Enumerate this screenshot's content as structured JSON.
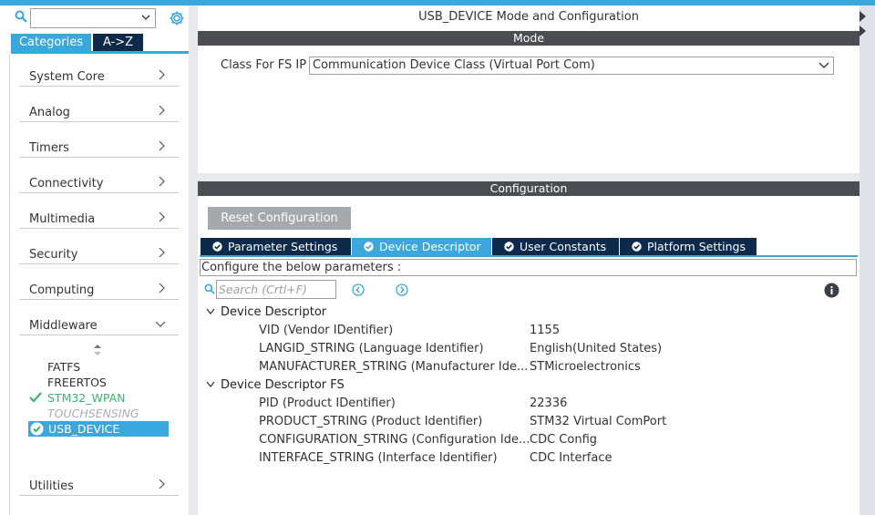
{
  "left_panel": {
    "search": {
      "value": ""
    },
    "tabs": {
      "categories": "Categories",
      "az": "A->Z"
    },
    "categories": [
      {
        "label": "System Core"
      },
      {
        "label": "Analog"
      },
      {
        "label": "Timers"
      },
      {
        "label": "Connectivity"
      },
      {
        "label": "Multimedia"
      },
      {
        "label": "Security"
      },
      {
        "label": "Computing"
      },
      {
        "label": "Middleware"
      },
      {
        "label": "Utilities"
      }
    ],
    "middleware_items": {
      "fatfs": "FATFS",
      "freertos": "FREERTOS",
      "stm32_wpan": "STM32_WPAN",
      "touchsensing": "TOUCHSENSING",
      "usb_device": "USB_DEVICE"
    }
  },
  "main": {
    "title": "USB_DEVICE Mode and Configuration",
    "mode_header": "Mode",
    "class_label": "Class For FS IP",
    "class_value": "Communication Device Class (Virtual Port Com)",
    "config_header": "Configuration",
    "reset_button": "Reset Configuration",
    "tabs": [
      {
        "label": "Parameter Settings"
      },
      {
        "label": "Device Descriptor"
      },
      {
        "label": "User Constants"
      },
      {
        "label": "Platform Settings"
      }
    ],
    "configure_text": "Configure the below parameters :",
    "search_placeholder": "Search (Crtl+F)",
    "groups": [
      {
        "title": "Device Descriptor",
        "params": [
          {
            "name": "VID (Vendor IDentifier)",
            "value": "1155"
          },
          {
            "name": "LANGID_STRING (Language Identifier)",
            "value": "English(United States)"
          },
          {
            "name": "MANUFACTURER_STRING (Manufacturer Ide...",
            "value": "STMicroelectronics"
          }
        ]
      },
      {
        "title": "Device Descriptor FS",
        "params": [
          {
            "name": "PID (Product IDentifier)",
            "value": "22336"
          },
          {
            "name": "PRODUCT_STRING (Product Identifier)",
            "value": "STM32 Virtual ComPort"
          },
          {
            "name": "CONFIGURATION_STRING (Configuration Ide...",
            "value": "CDC Config"
          },
          {
            "name": "INTERFACE_STRING (Interface Identifier)",
            "value": "CDC Interface"
          }
        ]
      }
    ]
  },
  "colors": {
    "accent": "#3aa8dc",
    "dark_tab": "#0d2a4a",
    "header": "#4a4d52",
    "success": "#3cb36f"
  }
}
